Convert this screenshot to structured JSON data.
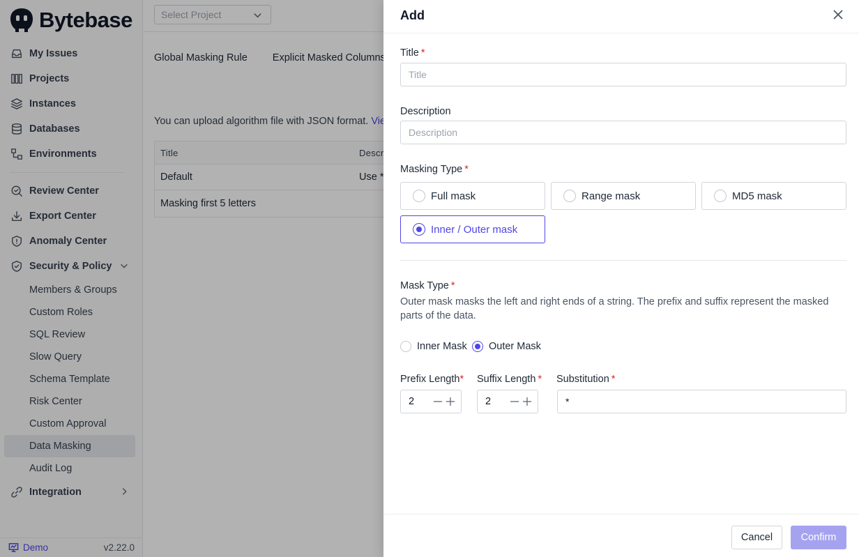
{
  "brand": {
    "name": "Bytebase"
  },
  "sidebar": {
    "items": [
      {
        "label": "My Issues",
        "icon": "inbox-icon"
      },
      {
        "label": "Projects",
        "icon": "projects-icon"
      },
      {
        "label": "Instances",
        "icon": "layers-icon"
      },
      {
        "label": "Databases",
        "icon": "database-icon"
      },
      {
        "label": "Environments",
        "icon": "environments-icon"
      }
    ],
    "center_items": [
      {
        "label": "Review Center",
        "icon": "search-check-icon"
      },
      {
        "label": "Export Center",
        "icon": "download-icon"
      },
      {
        "label": "Anomaly Center",
        "icon": "shield-alert-icon"
      }
    ],
    "security": {
      "label": "Security & Policy",
      "icon": "shield-check-icon"
    },
    "security_sub": [
      "Members & Groups",
      "Custom Roles",
      "SQL Review",
      "Slow Query",
      "Schema Template",
      "Risk Center",
      "Custom Approval",
      "Data Masking",
      "Audit Log"
    ],
    "integration": {
      "label": "Integration",
      "icon": "link-icon"
    },
    "footer": {
      "demo": "Demo",
      "version": "v2.22.0"
    }
  },
  "main": {
    "select_project_placeholder": "Select Project",
    "tabs": [
      "Global Masking Rule",
      "Explicit Masked Columns"
    ],
    "hint": "You can upload algorithm file with JSON format.",
    "hint_link": "Vie",
    "table": {
      "headers": [
        "Title",
        "Descr"
      ],
      "rows": [
        {
          "title": "Default",
          "desc": "Use *"
        },
        {
          "title": "Masking first 5 letters",
          "desc": ""
        }
      ]
    }
  },
  "drawer": {
    "title": "Add",
    "title_label": "Title",
    "title_placeholder": "Title",
    "description_label": "Description",
    "description_placeholder": "Description",
    "masking_type_label": "Masking Type",
    "masking_types": [
      "Full mask",
      "Range mask",
      "MD5 mask",
      "Inner / Outer mask"
    ],
    "selected_masking_type": "Inner / Outer mask",
    "mask_type_label": "Mask Type",
    "mask_type_description": "Outer mask masks the left and right ends of a string. The prefix and suffix represent the masked parts of the data.",
    "mask_options": [
      "Inner Mask",
      "Outer Mask"
    ],
    "selected_mask_option": "Outer Mask",
    "prefix_label": "Prefix Length",
    "prefix_value": "2",
    "suffix_label": "Suffix Length",
    "suffix_value": "2",
    "substitution_label": "Substitution",
    "substitution_value": "*",
    "required_mark": "*",
    "cancel_label": "Cancel",
    "confirm_label": "Confirm"
  },
  "colors": {
    "accent": "#4f46e5",
    "required": "#dc2626",
    "confirm_disabled": "#a5a3f0"
  }
}
